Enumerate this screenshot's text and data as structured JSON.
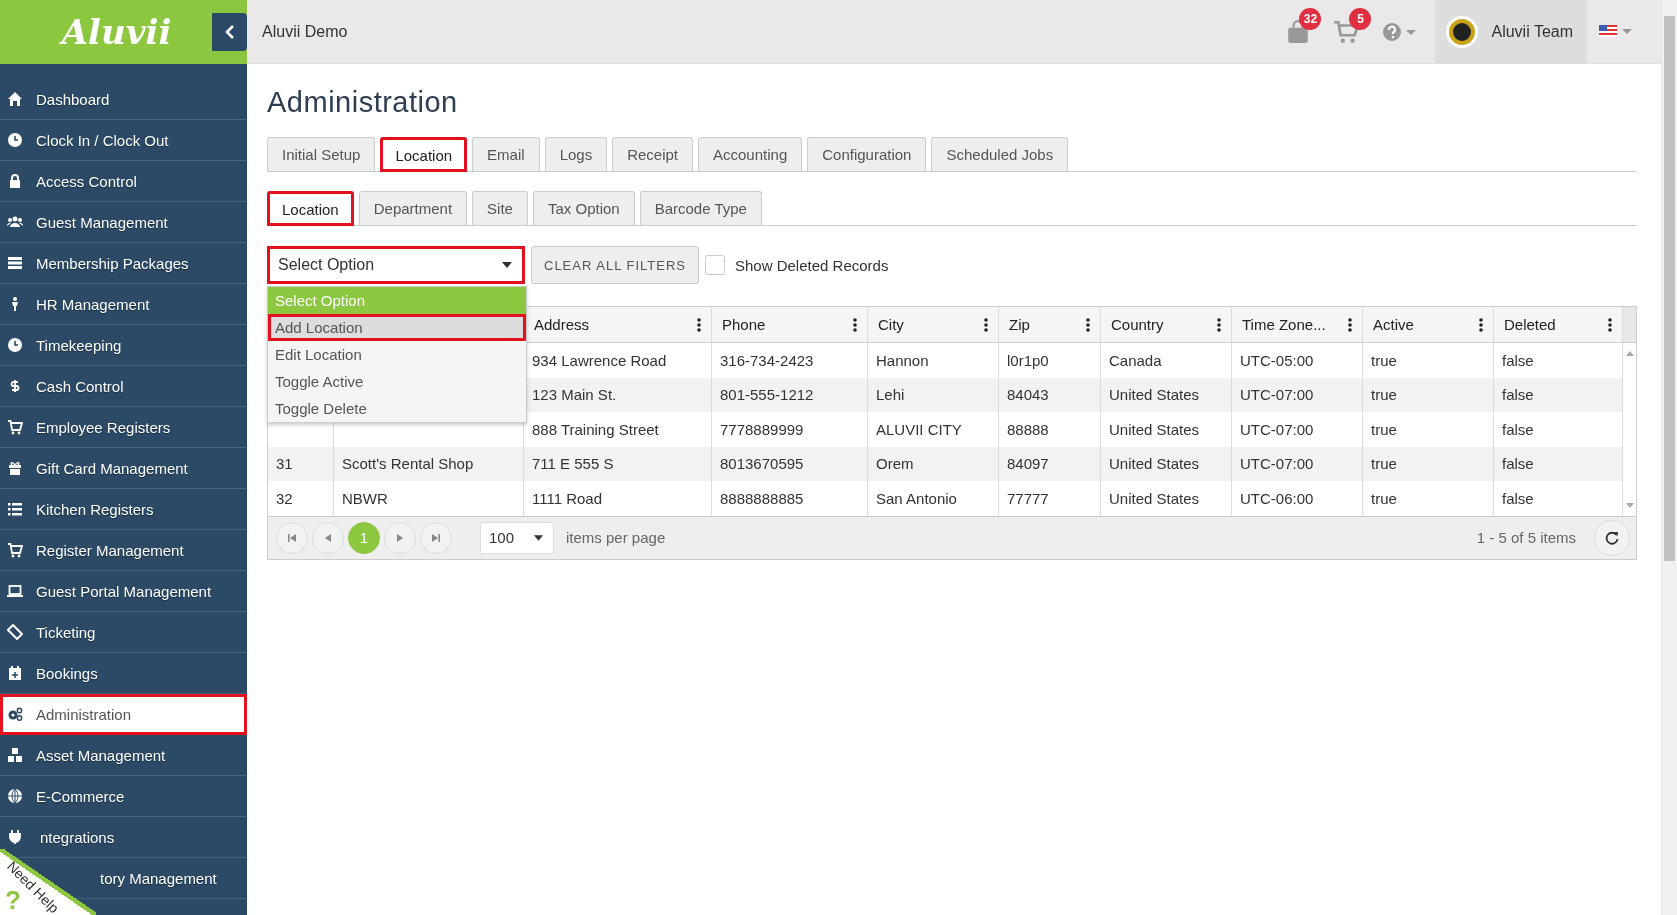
{
  "app": {
    "logo": "Aluvii"
  },
  "top_bar": {
    "title": "Aluvii Demo",
    "bag_badge": "32",
    "cart_badge": "5",
    "user": "Aluvii Team"
  },
  "sidebar": {
    "items": [
      {
        "label": "Dashboard",
        "selected": false,
        "highlighted": false
      },
      {
        "label": "Clock In / Clock Out",
        "selected": false,
        "highlighted": false
      },
      {
        "label": "Access Control",
        "selected": false,
        "highlighted": false
      },
      {
        "label": "Guest Management",
        "selected": false,
        "highlighted": false
      },
      {
        "label": "Membership Packages",
        "selected": false,
        "highlighted": false
      },
      {
        "label": "HR Management",
        "selected": false,
        "highlighted": false
      },
      {
        "label": "Timekeeping",
        "selected": false,
        "highlighted": false
      },
      {
        "label": "Cash Control",
        "selected": false,
        "highlighted": false
      },
      {
        "label": "Employee Registers",
        "selected": false,
        "highlighted": false
      },
      {
        "label": "Gift Card Management",
        "selected": false,
        "highlighted": false
      },
      {
        "label": "Kitchen Registers",
        "selected": false,
        "highlighted": false
      },
      {
        "label": "Register Management",
        "selected": false,
        "highlighted": false
      },
      {
        "label": "Guest Portal Management",
        "selected": false,
        "highlighted": false
      },
      {
        "label": "Ticketing",
        "selected": false,
        "highlighted": false
      },
      {
        "label": "Bookings",
        "selected": false,
        "highlighted": false
      },
      {
        "label": "Administration",
        "selected": true,
        "highlighted": true
      },
      {
        "label": "Asset Management",
        "selected": false,
        "highlighted": false
      },
      {
        "label": "E-Commerce",
        "selected": false,
        "highlighted": false
      },
      {
        "label": "ntegrations",
        "selected": false,
        "highlighted": false
      },
      {
        "label": "tory Management",
        "selected": false,
        "highlighted": false
      }
    ]
  },
  "page": {
    "title": "Administration"
  },
  "tabs": [
    {
      "label": "Initial Setup",
      "selected": false,
      "highlighted": false
    },
    {
      "label": "Location",
      "selected": true,
      "highlighted": true
    },
    {
      "label": "Email",
      "selected": false,
      "highlighted": false
    },
    {
      "label": "Logs",
      "selected": false,
      "highlighted": false
    },
    {
      "label": "Receipt",
      "selected": false,
      "highlighted": false
    },
    {
      "label": "Accounting",
      "selected": false,
      "highlighted": false
    },
    {
      "label": "Configuration",
      "selected": false,
      "highlighted": false
    },
    {
      "label": "Scheduled Jobs",
      "selected": false,
      "highlighted": false
    }
  ],
  "subtabs": [
    {
      "label": "Location",
      "selected": true,
      "highlighted": true
    },
    {
      "label": "Department",
      "selected": false,
      "highlighted": false
    },
    {
      "label": "Site",
      "selected": false,
      "highlighted": false
    },
    {
      "label": "Tax Option",
      "selected": false,
      "highlighted": false
    },
    {
      "label": "Barcode Type",
      "selected": false,
      "highlighted": false
    }
  ],
  "filters": {
    "select": {
      "value": "Select Option",
      "highlighted": true
    },
    "clear_button": "CLEAR ALL FILTERS",
    "show_deleted": {
      "label": "Show Deleted Records",
      "checked": false
    }
  },
  "dropdown": {
    "items": [
      {
        "label": "Select Option",
        "selected": true,
        "highlighted": false
      },
      {
        "label": "Add Location",
        "selected": false,
        "highlighted": true
      },
      {
        "label": "Edit Location",
        "selected": false,
        "highlighted": false
      },
      {
        "label": "Toggle Active",
        "selected": false,
        "highlighted": false
      },
      {
        "label": "Toggle Delete",
        "selected": false,
        "highlighted": false
      }
    ]
  },
  "table": {
    "columns": [
      "Address",
      "Phone",
      "City",
      "Zip",
      "Country",
      "Time Zone...",
      "Active",
      "Deleted"
    ],
    "rows": [
      {
        "cells": [
          "934 Lawrence Road",
          "316-734-2423",
          "Hannon",
          "l0r1p0",
          "Canada",
          "UTC-05:00",
          "true",
          "false"
        ]
      },
      {
        "cells": [
          "123 Main St.",
          "801-555-1212",
          "Lehi",
          "84043",
          "United States",
          "UTC-07:00",
          "true",
          "false"
        ]
      },
      {
        "cells": [
          "888 Training Street",
          "7778889999",
          "ALUVII CITY",
          "88888",
          "United States",
          "UTC-07:00",
          "true",
          "false"
        ]
      },
      {
        "id": "31",
        "name": "Scott's Rental Shop",
        "cells": [
          "711 E 555 S",
          "8013670595",
          "Orem",
          "84097",
          "United States",
          "UTC-07:00",
          "true",
          "false"
        ]
      },
      {
        "id": "32",
        "name": "NBWR",
        "cells": [
          "1111 Road",
          "8888888885",
          "San Antonio",
          "77777",
          "United States",
          "UTC-06:00",
          "true",
          "false"
        ]
      }
    ]
  },
  "pagination": {
    "pages": [
      {
        "label": "1",
        "selected": true
      }
    ],
    "page_size": "100",
    "page_size_label": "items per page",
    "summary": "1 - 5 of 5 items"
  },
  "help_ribbon": {
    "label": "Need Help",
    "mark": "?"
  }
}
